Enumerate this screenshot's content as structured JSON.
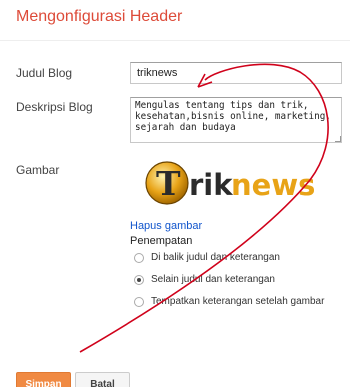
{
  "dialog": {
    "title": "Mengonfigurasi Header"
  },
  "form": {
    "blog_title_label": "Judul Blog",
    "blog_title_value": "triknews",
    "description_label": "Deskripsi Blog",
    "description_value": "Mengulas tentang tips dan trik,\nkesehatan,bisnis online, marketing,\nsejarah dan budaya",
    "image_label": "Gambar",
    "logo_text_t": "T",
    "logo_text_rik": "rik",
    "logo_text_news": "news",
    "remove_image_link": "Hapus gambar",
    "placement_label": "Penempatan",
    "placement_options": [
      {
        "label": "Di balik judul dan keterangan",
        "checked": false
      },
      {
        "label": "Selain judul dan keterangan",
        "checked": true
      },
      {
        "label": "Tempatkan keterangan setelah gambar",
        "checked": false
      }
    ]
  },
  "buttons": {
    "save": "Simpan",
    "cancel": "Batal"
  },
  "colors": {
    "title": "#dd4b39",
    "link": "#1155cc",
    "save_button": "#f08a43",
    "annotation_arrow": "#d0021b",
    "logo_gold": "#e8a317",
    "logo_dark": "#2b2b2b"
  }
}
